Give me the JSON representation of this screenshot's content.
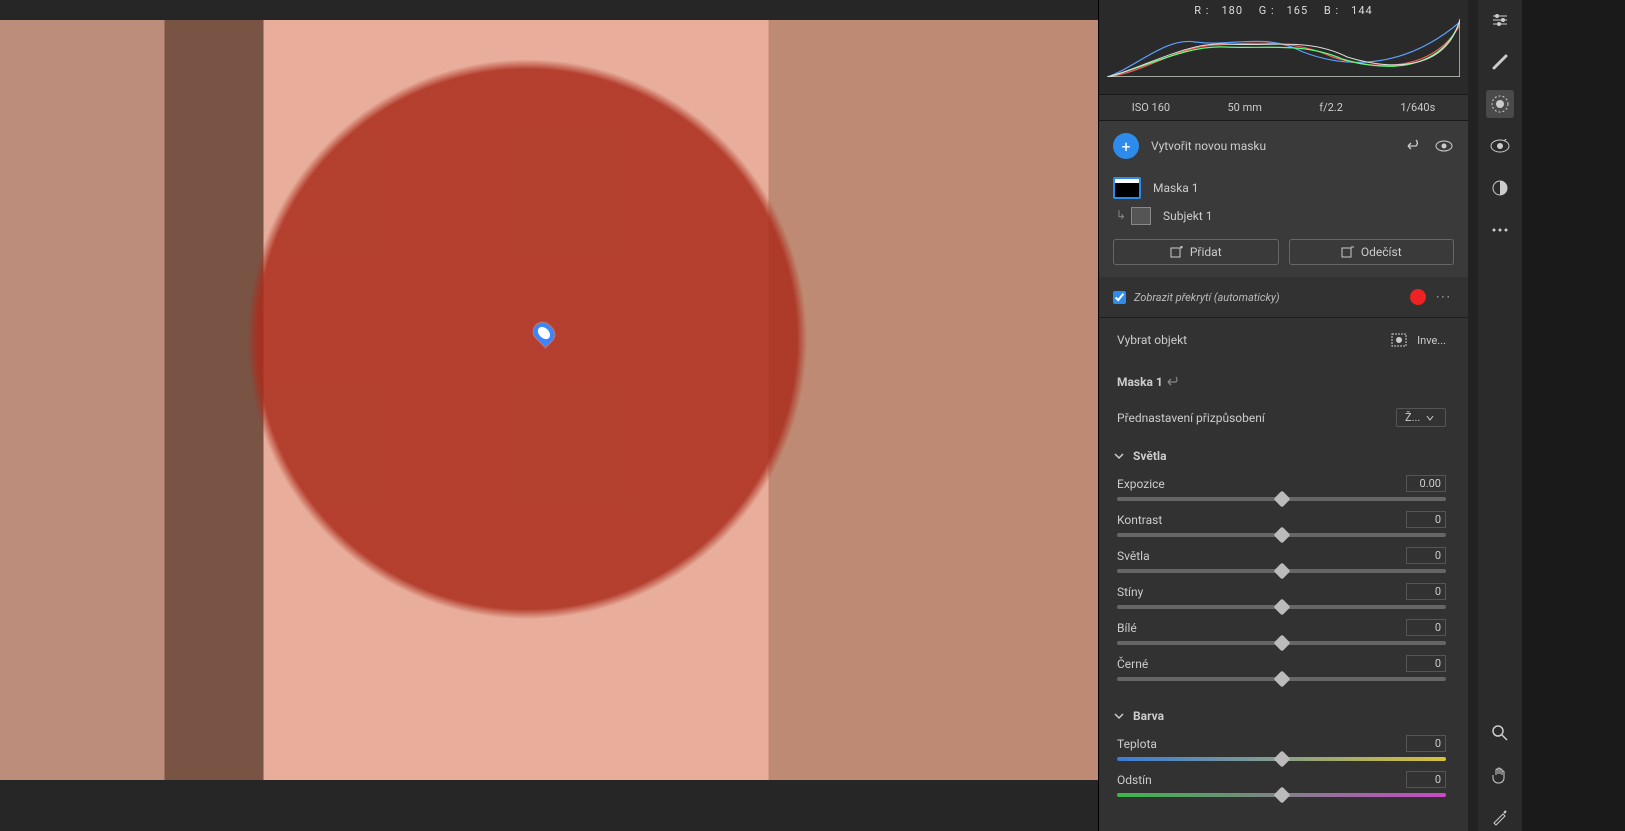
{
  "readout": {
    "r_label": "R :",
    "r": "180",
    "g_label": "G :",
    "g": "165",
    "b_label": "B :",
    "b": "144"
  },
  "meta": {
    "iso": "ISO 160",
    "focal": "50 mm",
    "aperture": "f/2.2",
    "shutter": "1/640s"
  },
  "mask_panel": {
    "create_label": "Vytvořit novou masku",
    "mask_name": "Maska 1",
    "subject_name": "Subjekt 1",
    "add_btn": "Přidat",
    "subtract_btn": "Odečíst"
  },
  "overlay": {
    "label": "Zobrazit překrytí (automaticky)"
  },
  "select_obj": {
    "label": "Vybrat objekt",
    "invert": "Inve..."
  },
  "mask_hdr": "Maska 1",
  "preset": {
    "label": "Přednastavení přizpůsobení",
    "value": "Ž..."
  },
  "sections": {
    "light": "Světla",
    "color": "Barva"
  },
  "sliders": {
    "exposure": {
      "label": "Expozice",
      "value": "0.00"
    },
    "contrast": {
      "label": "Kontrast",
      "value": "0"
    },
    "highlights": {
      "label": "Světla",
      "value": "0"
    },
    "shadows": {
      "label": "Stíny",
      "value": "0"
    },
    "whites": {
      "label": "Bílé",
      "value": "0"
    },
    "blacks": {
      "label": "Černé",
      "value": "0"
    },
    "temp": {
      "label": "Teplota",
      "value": "0"
    },
    "tint": {
      "label": "Odstín",
      "value": "0"
    }
  }
}
